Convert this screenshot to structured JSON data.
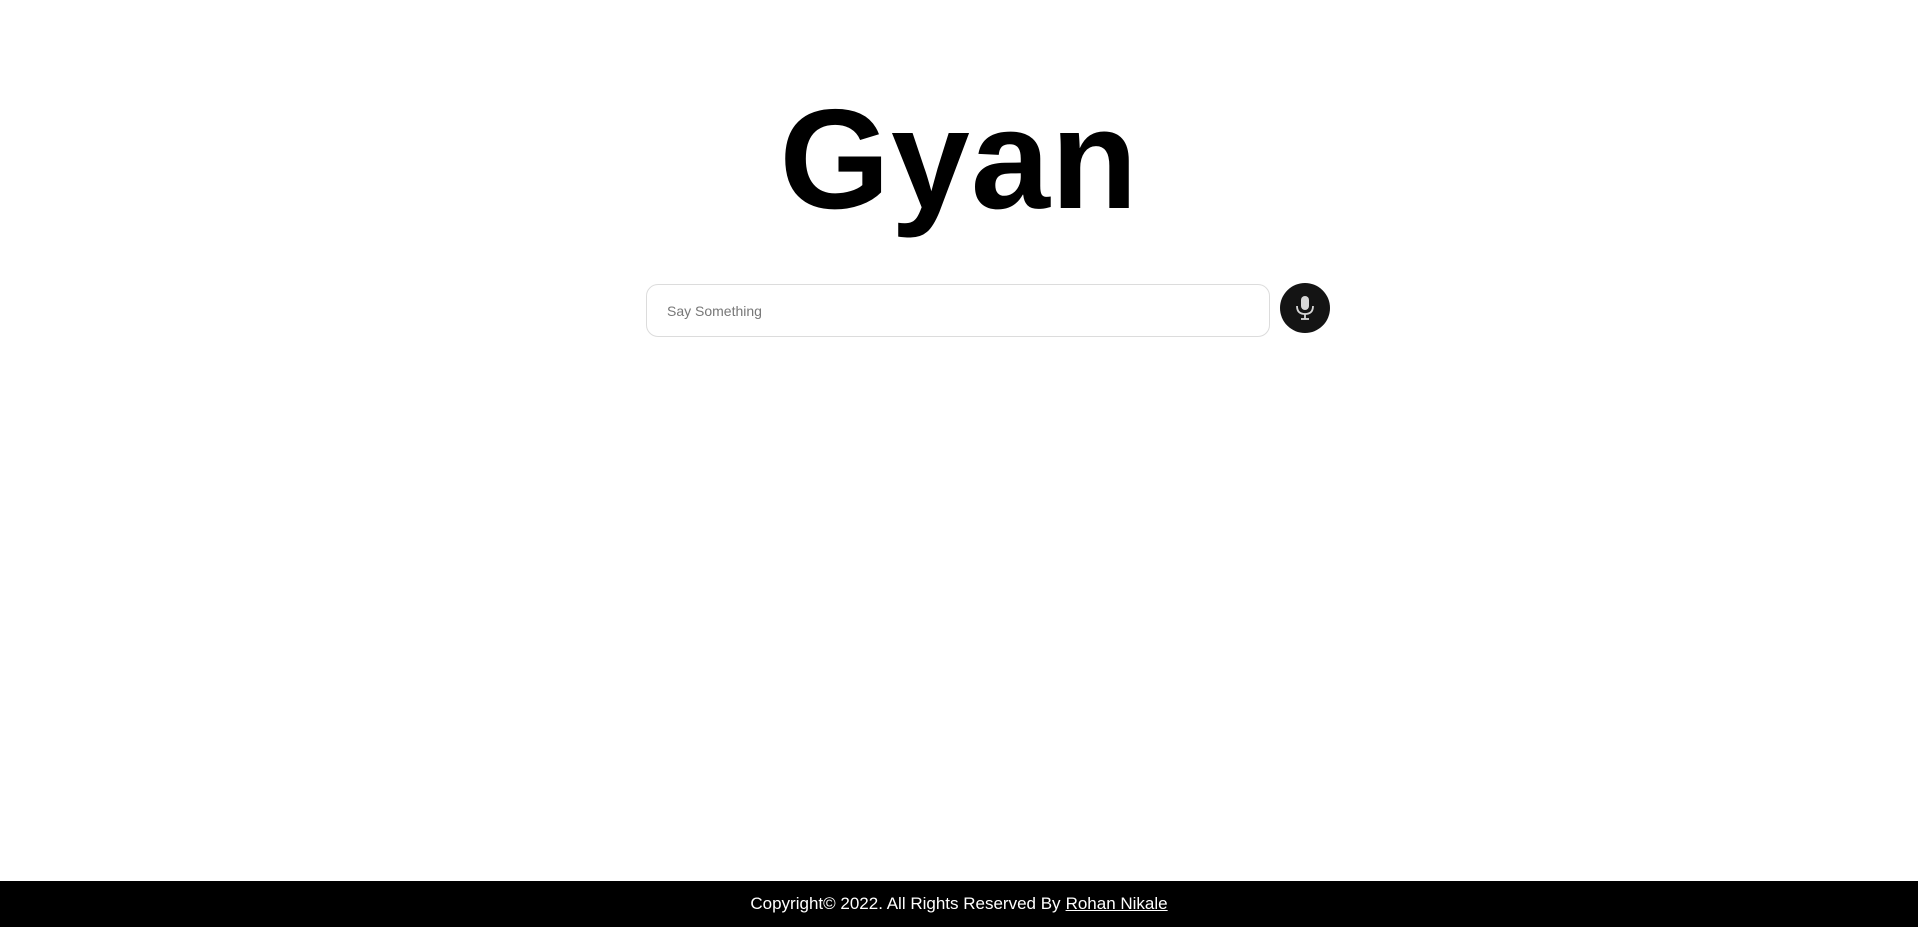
{
  "header": {
    "title": "Gyan"
  },
  "search": {
    "placeholder": "Say Something",
    "value": ""
  },
  "mic_button": {
    "icon": "microphone-icon"
  },
  "footer": {
    "copyright_text": "Copyright© 2022. All Rights Reserved By",
    "author_link": "Rohan Nikale"
  },
  "colors": {
    "background": "#ffffff",
    "title": "#000000",
    "mic_button_bg": "#141414",
    "footer_bg": "#000000",
    "footer_text": "#ffffff"
  }
}
